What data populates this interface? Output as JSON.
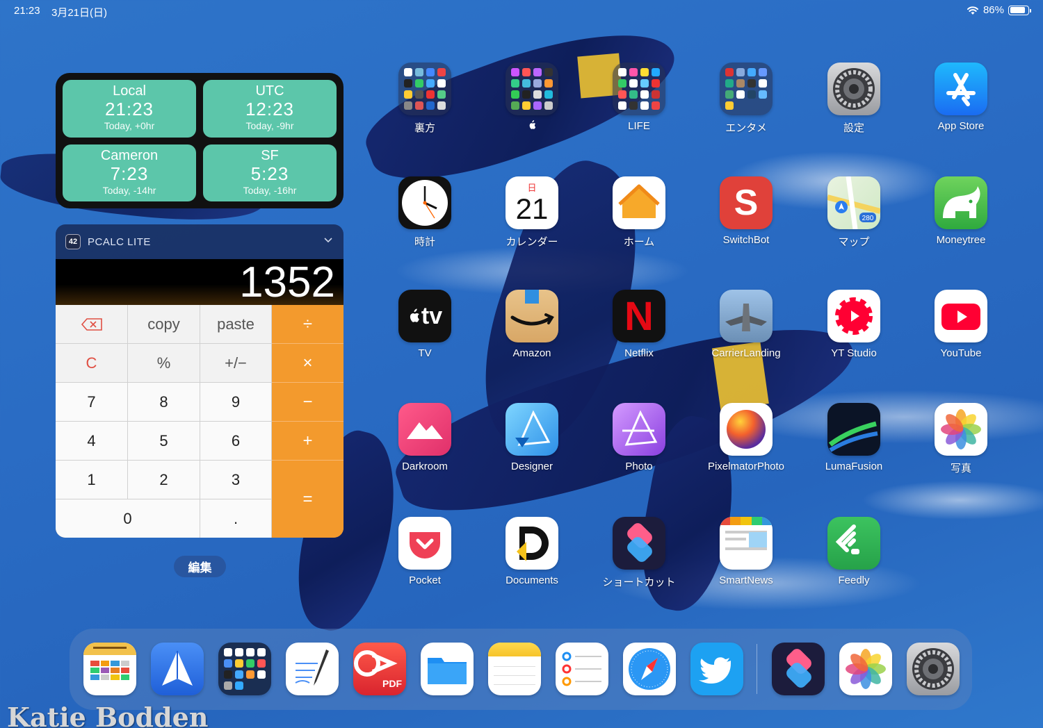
{
  "status_bar": {
    "time": "21:23",
    "date": "3月21日(日)",
    "battery": "86%"
  },
  "world_clock": [
    {
      "name": "Local",
      "time": "21:23",
      "offset": "Today, +0hr"
    },
    {
      "name": "UTC",
      "time": "12:23",
      "offset": "Today, -9hr"
    },
    {
      "name": "Cameron",
      "time": "7:23",
      "offset": "Today, -14hr"
    },
    {
      "name": "SF",
      "time": "5:23",
      "offset": "Today, -16hr"
    }
  ],
  "calculator": {
    "badge": "42",
    "title": "PCALC LITE",
    "display": "1352",
    "keys": {
      "copy": "copy",
      "paste": "paste",
      "divide": "÷",
      "clear": "C",
      "percent": "%",
      "sign": "+/−",
      "multiply": "×",
      "seven": "7",
      "eight": "8",
      "nine": "9",
      "minus": "−",
      "four": "4",
      "five": "5",
      "six": "6",
      "plus": "+",
      "one": "1",
      "two": "2",
      "three": "3",
      "equals": "=",
      "zero": "0",
      "dot": "."
    }
  },
  "edit_button": "編集",
  "apps": {
    "ura": "裏方",
    "apple": "",
    "life": "LIFE",
    "entame": "エンタメ",
    "settings": "設定",
    "appstore": "App Store",
    "clock": "時計",
    "calendar": "カレンダー",
    "home": "ホーム",
    "switchbot": "SwitchBot",
    "maps": "マップ",
    "moneytree": "Moneytree",
    "tv": "TV",
    "amazon": "Amazon",
    "netflix": "Netflix",
    "carrier": "CarrierLanding",
    "ytstudio": "YT Studio",
    "youtube": "YouTube",
    "darkroom": "Darkroom",
    "designer": "Designer",
    "photo": "Photo",
    "pixelmator": "PixelmatorPhoto",
    "lumafusion": "LumaFusion",
    "photos": "写真",
    "pocket": "Pocket",
    "documents": "Documents",
    "shortcuts": "ショートカット",
    "smartnews": "SmartNews",
    "feedly": "Feedly"
  },
  "icon_text": {
    "calendar_day": "日",
    "calendar_date": "21",
    "tv": "tv",
    "netflix": "N",
    "switchbot": "S",
    "maps_route": "280",
    "pdf": "PDF"
  },
  "watermark": "Katie Bodden",
  "colors": {
    "widget_teal": "#5cc6aa",
    "calc_orange": "#f39a2d",
    "wallpaper_blue": "#2a6cc4"
  }
}
